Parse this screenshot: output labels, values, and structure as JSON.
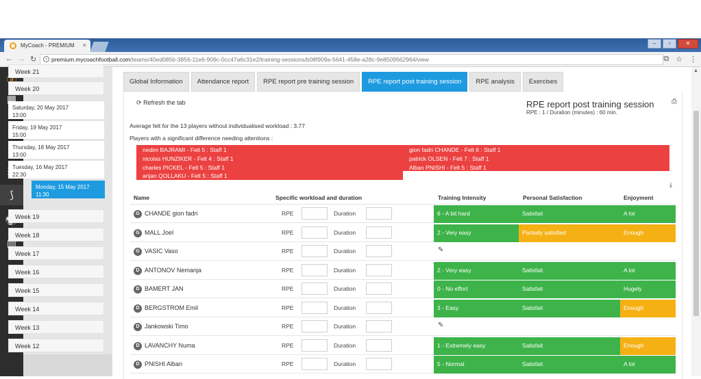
{
  "browser": {
    "tab_title": "MyCoach - PREMIUM",
    "close_glyph": "×",
    "url_host": "premium.mycoachfootball.com",
    "url_path": "/teams/40ed085b-3856-11e6-909c-0cc47a6c31e2/training-sessions/b08f909a-5641-458e-a28c-9e8509562964/view"
  },
  "weeks_top": [
    {
      "label": "Week 21"
    },
    {
      "label": "Week 20"
    }
  ],
  "sessions": [
    {
      "label": "Saturday, 20 May 2017",
      "time": "13:00"
    },
    {
      "label": "Friday, 19 May 2017",
      "time": "15:00"
    },
    {
      "label": "Thursday, 18 May 2017",
      "time": "13:00"
    },
    {
      "label": "Tuesday, 16 May 2017",
      "time": "22:30"
    },
    {
      "label": "Monday, 15 May 2017",
      "time": "11:30",
      "active": true
    }
  ],
  "weeks_bottom": [
    {
      "label": "Week 19"
    },
    {
      "label": "Week 18"
    },
    {
      "label": "Week 17"
    },
    {
      "label": "Week 16"
    },
    {
      "label": "Week 15"
    },
    {
      "label": "Week 14"
    },
    {
      "label": "Week 13"
    },
    {
      "label": "Week 12"
    }
  ],
  "tabs": [
    {
      "label": "Global Information"
    },
    {
      "label": "Attendance report"
    },
    {
      "label": "RPE report pre training session"
    },
    {
      "label": "RPE report post training session",
      "active": true
    },
    {
      "label": "RPE analysis"
    },
    {
      "label": "Exercises"
    }
  ],
  "report": {
    "refresh_label": "Refresh the tab",
    "title": "RPE report post training session",
    "subtitle": "RPE : 1 / Duration (minutes) : 60 min.",
    "average_text": "Average felt for the 13 players without individualised workload : 3.77",
    "difference_heading": "Players with a significant difference needing attentions :",
    "alerts_left": [
      "nedim BAJRAMI - Felt 5 : Staff 1",
      "nicolas HUNZIKER - Felt 4 : Staff 1",
      "charles PICKEL - Felt 5 : Staff 1",
      "arijan QOLLAKU - Felt 5 : Staff 1"
    ],
    "alerts_right": [
      "gion fadri CHANDE - Felt 6 : Staff 1",
      "patrick OLSEN - Felt 7 : Staff 1",
      "Alban PNISHI - Felt 5 : Staff 1"
    ]
  },
  "table": {
    "headers": {
      "name": "Name",
      "workload": "Specific workload and duration",
      "intensity": "Training Intensity",
      "satisfaction": "Personal Satisfaction",
      "enjoyment": "Enjoyment"
    },
    "rpe_label": "RPE",
    "duration_label": "Duration",
    "colors": {
      "green": "#3db34a",
      "orange": "#f5b014",
      "alert": "#ec4141",
      "accent": "#1e9be0"
    },
    "rows": [
      {
        "pos": "G",
        "name": "CHANDE gion fadri",
        "intensity": "6 - A bit hard",
        "satisfaction": "Satisfait",
        "enjoyment": "A lot",
        "int_c": "green",
        "sat_c": "green",
        "enj_c": "green"
      },
      {
        "pos": "G",
        "name": "MALL Joel",
        "intensity": "2 - Very easy",
        "satisfaction": "Partially satisfied",
        "enjoyment": "Enough",
        "int_c": "green",
        "sat_c": "orange",
        "enj_c": "orange"
      },
      {
        "pos": "G",
        "name": "VASIC Vaso",
        "edit": true
      },
      {
        "pos": "D",
        "name": "ANTONOV Nemanja",
        "intensity": "2 - Very easy",
        "satisfaction": "Satisfait",
        "enjoyment": "A lot",
        "int_c": "green",
        "sat_c": "green",
        "enj_c": "green"
      },
      {
        "pos": "D",
        "name": "BAMERT JAN",
        "intensity": "0 - No effort",
        "satisfaction": "Satisfait",
        "enjoyment": "Hugely",
        "int_c": "green",
        "sat_c": "green",
        "enj_c": "green"
      },
      {
        "pos": "D",
        "name": "BERGSTROM Emil",
        "intensity": "3 - Easy",
        "satisfaction": "Satisfait",
        "enjoyment": "Enough",
        "int_c": "green",
        "sat_c": "green",
        "enj_c": "orange"
      },
      {
        "pos": "D",
        "name": "Jankowski Timo",
        "edit": true
      },
      {
        "pos": "D",
        "name": "LAVANCHY Numa",
        "intensity": "1 - Extremely easy",
        "satisfaction": "Satisfait",
        "enjoyment": "Enough",
        "int_c": "green",
        "sat_c": "green",
        "enj_c": "orange"
      },
      {
        "pos": "D",
        "name": "PNISHI Alban",
        "intensity": "5 - Normal",
        "satisfaction": "Satisfait",
        "enjoyment": "A lot",
        "int_c": "green",
        "sat_c": "green",
        "enj_c": "green"
      }
    ]
  }
}
